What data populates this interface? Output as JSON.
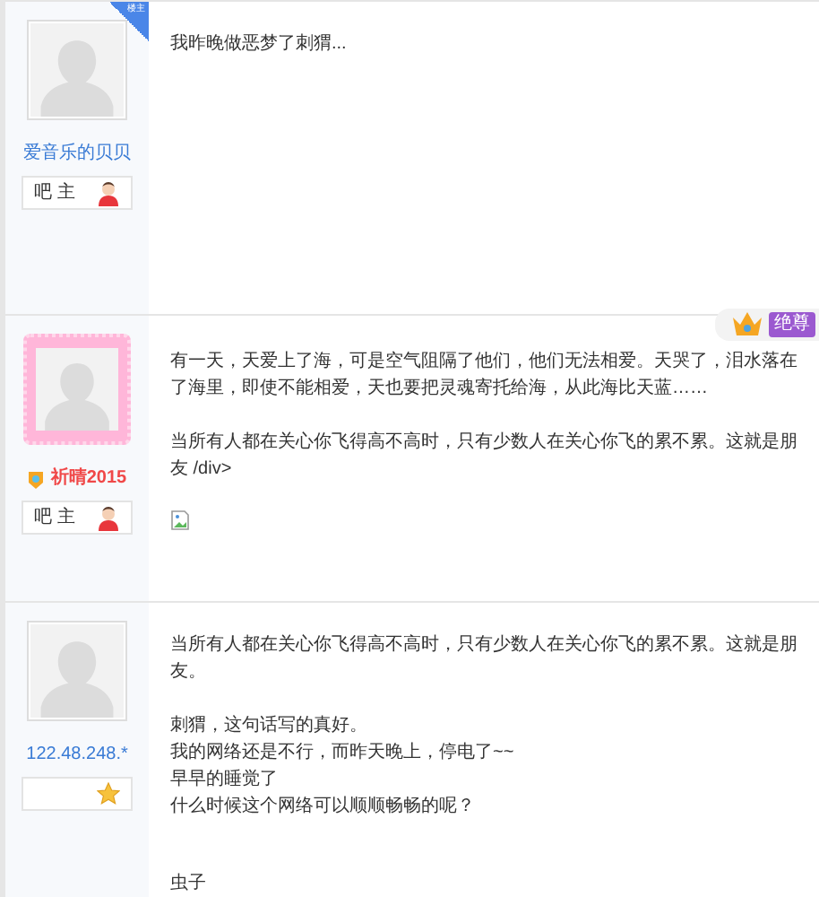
{
  "posts": [
    {
      "corner_tag": "楼主",
      "avatar": {
        "kind": "plain"
      },
      "author": {
        "name": "爱音乐的贝贝",
        "kind": "user"
      },
      "badge": {
        "label": "吧 主",
        "kind": "moderator"
      },
      "body": [
        {
          "kind": "text",
          "text": "我昨晚做恶梦了刺猬..."
        }
      ]
    },
    {
      "vip": {
        "label": "绝尊"
      },
      "avatar": {
        "kind": "lace"
      },
      "author": {
        "name": "祈晴2015",
        "kind": "vip"
      },
      "badge": {
        "label": "吧 主",
        "kind": "moderator"
      },
      "body": [
        {
          "kind": "text",
          "text": "有一天，天爱上了海，可是空气阻隔了他们，他们无法相爱。天哭了，泪水落在了海里，即使不能相爱，天也要把灵魂寄托给海，从此海比天蓝……"
        },
        {
          "kind": "text",
          "text": "当所有人都在关心你飞得高不高时，只有少数人在关心你飞的累不累。这就是朋友 /div>"
        },
        {
          "kind": "image"
        }
      ]
    },
    {
      "avatar": {
        "kind": "plain"
      },
      "author": {
        "name": "122.48.248.*",
        "kind": "ip"
      },
      "badge": {
        "kind": "guest"
      },
      "body": [
        {
          "kind": "text",
          "text": "当所有人都在关心你飞得高不高时，只有少数人在关心你飞的累不累。这就是朋友。"
        },
        {
          "kind": "lines",
          "lines": [
            "刺猬，这句话写的真好。",
            "我的网络还是不行，而昨天晚上，停电了~~",
            "早早的睡觉了",
            "什么时候这个网络可以顺顺畅畅的呢？"
          ]
        },
        {
          "kind": "signature",
          "text": "虫子"
        }
      ]
    }
  ]
}
